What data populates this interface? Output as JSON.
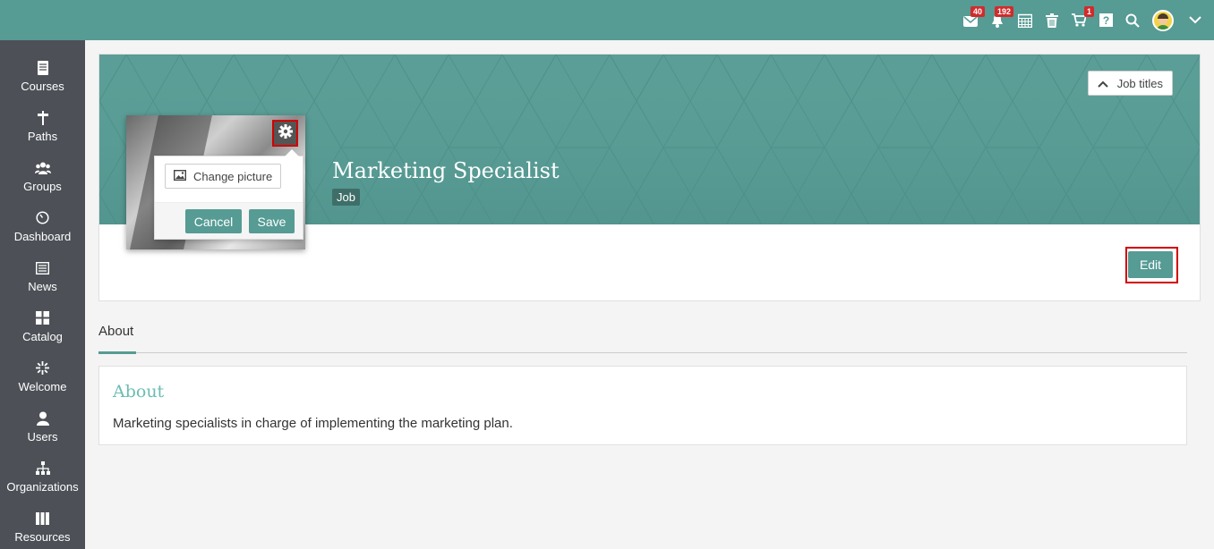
{
  "topbar": {
    "icons": [
      {
        "name": "mail-icon",
        "badge": "40"
      },
      {
        "name": "bell-icon",
        "badge": "192"
      },
      {
        "name": "calendar-icon"
      },
      {
        "name": "trash-icon"
      },
      {
        "name": "cart-icon",
        "badge": "1"
      },
      {
        "name": "help-icon"
      },
      {
        "name": "search-icon"
      },
      {
        "name": "avatar"
      },
      {
        "name": "chevron-down-icon"
      }
    ]
  },
  "sidebar": {
    "items": [
      {
        "label": "Courses",
        "icon": "book-icon"
      },
      {
        "label": "Paths",
        "icon": "signpost-icon"
      },
      {
        "label": "Groups",
        "icon": "group-icon"
      },
      {
        "label": "Dashboard",
        "icon": "dashboard-icon"
      },
      {
        "label": "News",
        "icon": "newspaper-icon"
      },
      {
        "label": "Catalog",
        "icon": "grid-icon"
      },
      {
        "label": "Welcome",
        "icon": "sparkle-icon"
      },
      {
        "label": "Users",
        "icon": "user-icon"
      },
      {
        "label": "Organizations",
        "icon": "org-chart-icon"
      },
      {
        "label": "Resources",
        "icon": "library-icon"
      }
    ]
  },
  "header": {
    "job_titles_label": "Job titles",
    "title": "Marketing Specialist",
    "tag": "Job",
    "edit_label": "Edit"
  },
  "popover": {
    "change_picture_label": "Change picture",
    "cancel_label": "Cancel",
    "save_label": "Save"
  },
  "tabs": [
    {
      "label": "About",
      "active": true
    }
  ],
  "about": {
    "title": "About",
    "text": "Marketing specialists in charge of implementing the marketing plan."
  },
  "colors": {
    "accent": "#569b94",
    "sidebar": "#4d5157",
    "badge": "#d12b2b",
    "highlight": "#d10000"
  }
}
